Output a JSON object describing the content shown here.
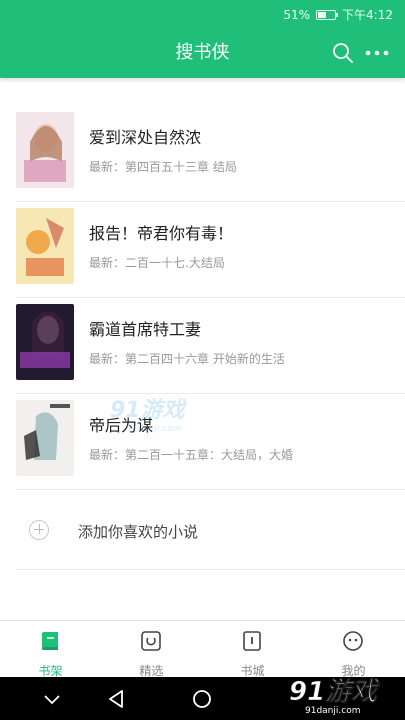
{
  "status_bar": {
    "battery": "51%",
    "time": "下午4:12",
    "battery_level": 0.51
  },
  "app_bar": {
    "title": "搜书侠",
    "search_icon": "search-icon",
    "more_icon": "more-icon"
  },
  "books": [
    {
      "title": "爱到深处自然浓",
      "latest": "最新：第四百五十三章 结局"
    },
    {
      "title": "报告！帝君你有毒！",
      "latest": "最新：二百一十七.大结局"
    },
    {
      "title": "霸道首席特工妻",
      "latest": "最新：第二百四十六章 开始新的生活"
    },
    {
      "title": "帝后为谋",
      "latest": "最新：第二百一十五章：大结局，大婚"
    }
  ],
  "add_book": {
    "label": "添加你喜欢的小说"
  },
  "watermark": {
    "big": "91游戏",
    "small": "91danji.com"
  },
  "tabs": [
    {
      "label": "书架",
      "icon": "bookshelf-icon",
      "active": true
    },
    {
      "label": "精选",
      "icon": "featured-icon",
      "active": false
    },
    {
      "label": "书城",
      "icon": "bookstore-icon",
      "active": false
    },
    {
      "label": "我的",
      "icon": "profile-icon",
      "active": false
    }
  ],
  "logo_watermark": {
    "big": "91游戏",
    "small": "91danji.com"
  },
  "colors": {
    "accent": "#1fbf79"
  }
}
